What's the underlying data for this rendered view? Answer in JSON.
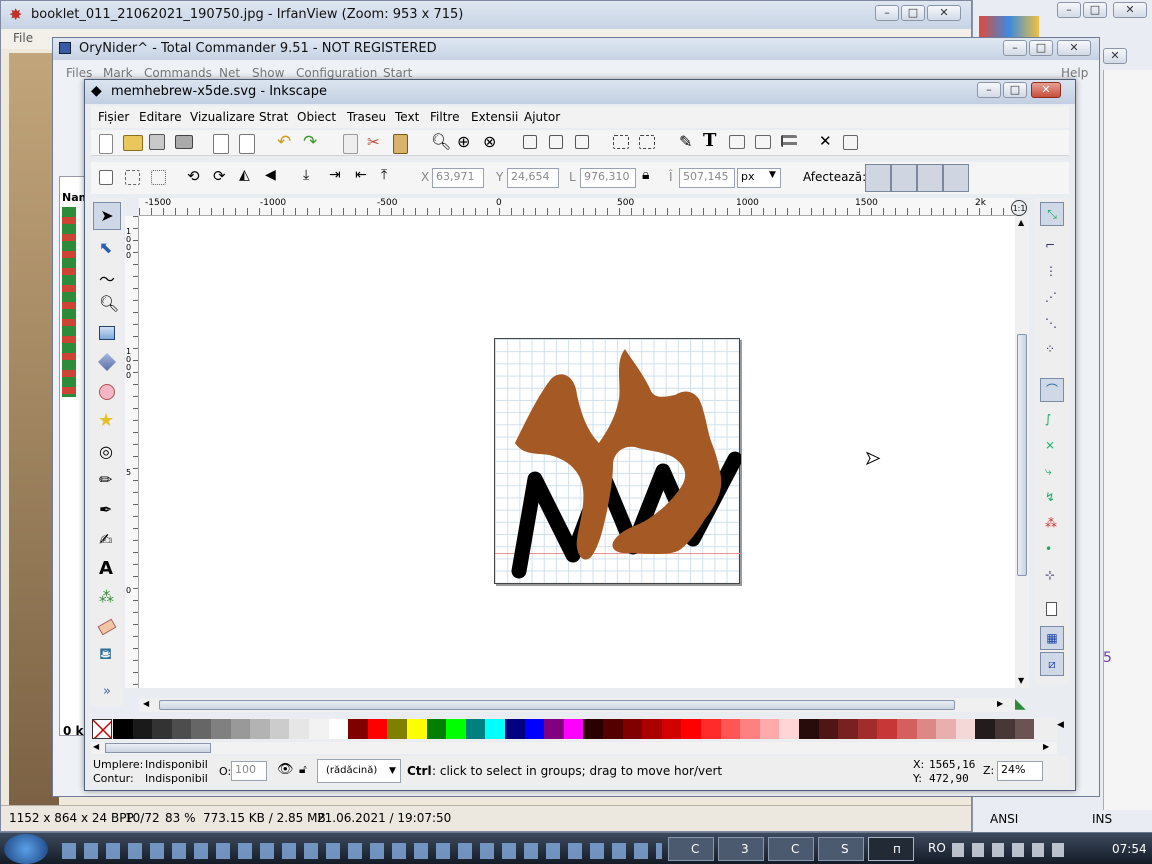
{
  "irfanview": {
    "title": "booklet_011_21062021_190750.jpg - IrfanView (Zoom: 953 x 715)",
    "menu_first": "File",
    "status": [
      "1152 x 864 x 24 BPP",
      "10/72",
      "83 %",
      "773.15 KB / 2.85 MB",
      "21.06.2021 / 19:07:50"
    ]
  },
  "totalcmd": {
    "title": "OryNider^ - Total Commander 9.51 - NOT REGISTERED",
    "menu": [
      "Files",
      "Mark",
      "Commands",
      "Net",
      "Show",
      "Configuration",
      "Start",
      "Help"
    ],
    "col_header": "Nam",
    "size_cell": "0 k",
    "status_ansi": "ANSI",
    "status_ins": "INS",
    "side_digit": "5"
  },
  "inkscape": {
    "title": "memhebrew-x5de.svg - Inkscape",
    "menu": [
      "Fișier",
      "Editare",
      "Vizualizare",
      "Strat",
      "Obiect",
      "Traseu",
      "Text",
      "Filtre",
      "Extensii",
      "Ajutor"
    ],
    "coords": {
      "x_label": "X",
      "x_value": "63,971",
      "y_label": "Y",
      "y_value": "24,654",
      "w_label": "L",
      "w_value": "976,310",
      "h_label": "Î",
      "h_value": "507,145",
      "unit": "px"
    },
    "affects_label": "Afectează:",
    "ruler_labels": [
      "-1500",
      "-1000",
      "-500",
      "0",
      "500",
      "1000",
      "1500",
      "2k"
    ],
    "vruler_labels": [
      "1000",
      "1000",
      "5",
      "0"
    ],
    "fill_label": "Umplere:",
    "fill_value": "Indisponibil",
    "stroke_label": "Contur:",
    "stroke_value": "Indisponibil",
    "opacity_label": "O:",
    "opacity_value": "100",
    "layer_value": "(rădăcină)",
    "status_key": "Ctrl",
    "status_message": ": click to select in groups; drag to move hor/vert",
    "cursor_x_label": "X:",
    "cursor_x": "1565,16",
    "cursor_y_label": "Y:",
    "cursor_y": "472,90",
    "zoom_label": "Z:",
    "zoom_value": "24%",
    "palette": [
      "#000000",
      "#1a1a1a",
      "#333333",
      "#4d4d4d",
      "#666666",
      "#808080",
      "#999999",
      "#b3b3b3",
      "#cccccc",
      "#e6e6e6",
      "#f2f2f2",
      "#ffffff",
      "#800000",
      "#ff0000",
      "#808000",
      "#ffff00",
      "#008000",
      "#00ff00",
      "#008080",
      "#00ffff",
      "#000080",
      "#0000ff",
      "#800080",
      "#ff00ff",
      "#2b0000",
      "#550000",
      "#800000",
      "#aa0000",
      "#d40000",
      "#ff0000",
      "#ff2a2a",
      "#ff5555",
      "#ff8080",
      "#ffaaaa",
      "#ffd5d5",
      "#280b0b",
      "#501616",
      "#782121",
      "#a02c2c",
      "#c83737",
      "#d35f5f",
      "#de8787",
      "#e9afaf",
      "#f4d7d7",
      "#241c1c",
      "#483737",
      "#6c5353"
    ]
  },
  "taskbar": {
    "items": [
      "C",
      "3",
      "C",
      "S",
      "п"
    ],
    "lang": "RO",
    "clock": "07:54"
  }
}
